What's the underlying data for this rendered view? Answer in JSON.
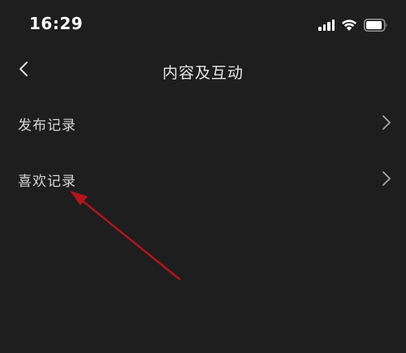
{
  "status_bar": {
    "time": "16:29",
    "icons": [
      "signal-icon",
      "wifi-icon",
      "battery-icon"
    ]
  },
  "nav": {
    "title": "内容及互动",
    "back_icon": "chevron-left-icon"
  },
  "menu": {
    "items": [
      {
        "label": "发布记录",
        "icon": "chevron-right-icon"
      },
      {
        "label": "喜欢记录",
        "icon": "chevron-right-icon"
      }
    ]
  },
  "colors": {
    "background": "#1e1e1f",
    "text": "#d4d4d4",
    "annotation_arrow": "#b3141a"
  }
}
